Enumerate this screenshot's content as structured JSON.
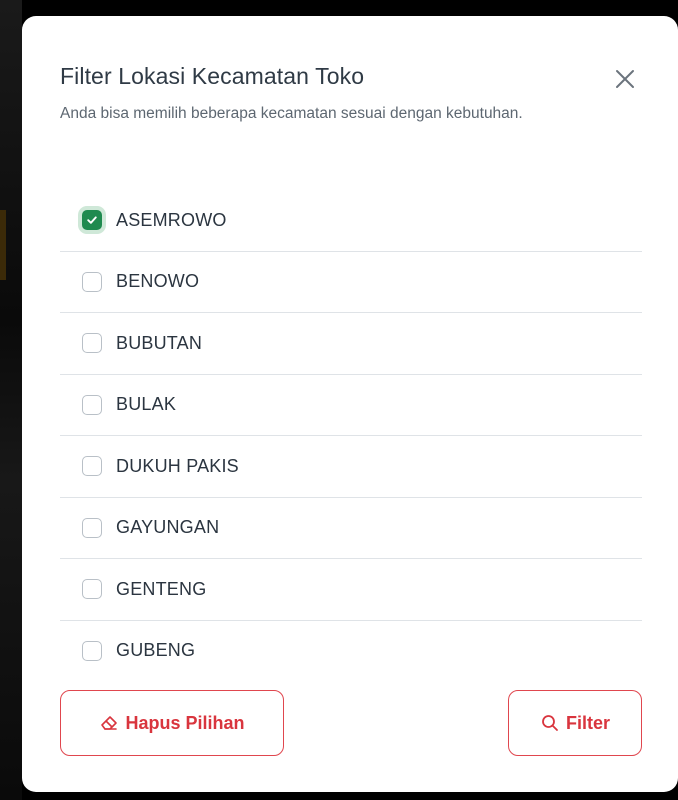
{
  "modal": {
    "title": "Filter Lokasi Kecamatan Toko",
    "description": "Anda bisa memilih beberapa kecamatan sesuai dengan kebutuhan."
  },
  "options": [
    {
      "label": "ASEMROWO",
      "checked": true
    },
    {
      "label": "BENOWO",
      "checked": false
    },
    {
      "label": "BUBUTAN",
      "checked": false
    },
    {
      "label": "BULAK",
      "checked": false
    },
    {
      "label": "DUKUH PAKIS",
      "checked": false
    },
    {
      "label": "GAYUNGAN",
      "checked": false
    },
    {
      "label": "GENTENG",
      "checked": false
    },
    {
      "label": "GUBENG",
      "checked": false
    }
  ],
  "footer": {
    "clear_label": "Hapus Pilihan",
    "clear_icon": "eraser-icon",
    "filter_label": "Filter",
    "filter_icon": "search-icon"
  },
  "colors": {
    "accent": "#d9353e",
    "checked": "#1f8a4f",
    "title": "#2f3a45"
  }
}
